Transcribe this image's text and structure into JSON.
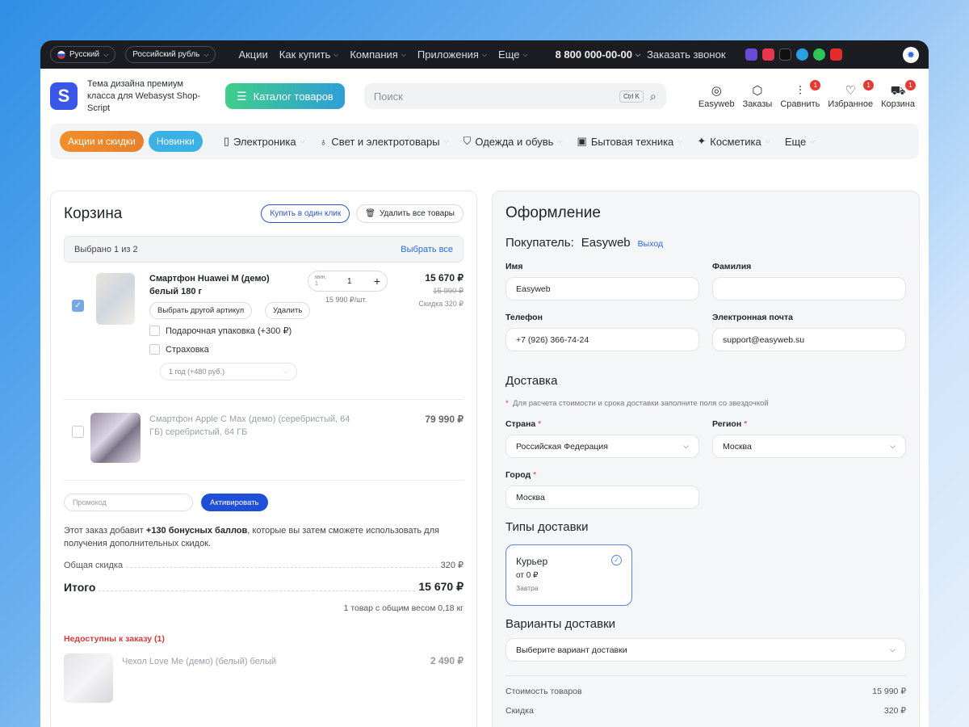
{
  "topbar": {
    "language": "Русский",
    "currency": "Российский рубль",
    "nav": [
      "Акции",
      "Как купить",
      "Компания",
      "Приложения",
      "Еще"
    ],
    "phone": "8 800 000-00-00",
    "callback": "Заказать звонок"
  },
  "header": {
    "tagline": "Тема дизайна премиум класса для Webasyst Shop-Script",
    "catalog_label": "Каталог товаров",
    "search_placeholder": "Поиск",
    "search_shortcut": "Ctrl K",
    "icons": [
      {
        "label": "Easyweb",
        "badge": ""
      },
      {
        "label": "Заказы",
        "badge": ""
      },
      {
        "label": "Сравнить",
        "badge": "1"
      },
      {
        "label": "Избранное",
        "badge": "1"
      },
      {
        "label": "Корзина",
        "badge": "1"
      }
    ]
  },
  "catbar": {
    "promo_chip": "Акции и скидки",
    "new_chip": "Новинки",
    "categories": [
      "Электроника",
      "Свет и электротовары",
      "Одежда и обувь",
      "Бытовая техника",
      "Косметика",
      "Еще"
    ]
  },
  "cart": {
    "title": "Корзина",
    "buy_one_click": "Купить в один клик",
    "delete_all": "Удалить все товары",
    "selected_text": "Выбрано 1 из 2",
    "select_all": "Выбрать все",
    "item1": {
      "name": "Смартфон Huawei M (демо)",
      "variant": "белый   180 г",
      "change_sku": "Выбрать другой артикул",
      "delete": "Удалить",
      "option_gift": "Подарочная упаковка (+300 ₽)",
      "option_insurance": "Страховка",
      "insurance_select": "1 год (+480 руб.)",
      "qty_min_label": "мин.",
      "qty_min_value": "1",
      "qty": "1",
      "unit_price": "15 990 ₽/шт.",
      "price": "15 670 ₽",
      "old_price": "15 990 ₽",
      "discount": "Скидка 320 ₽"
    },
    "item2": {
      "name": "Смартфон Apple C Max (демо) (серебристый, 64 ГБ)  серебристый, 64 ГБ",
      "price": "79 990 ₽"
    },
    "promo_placeholder": "Промокод",
    "activate": "Активировать",
    "bonus_pre": "Этот заказ добавит ",
    "bonus_strong": "+130 бонусных баллов",
    "bonus_post": ", которые вы затем сможете использовать для получения дополнительных скидок.",
    "total_discount_label": "Общая скидка",
    "total_discount": "320 ₽",
    "total_label": "Итого",
    "total": "15 670 ₽",
    "weight_text": "1 товар с общим весом 0,18 кг",
    "unavailable_title": "Недоступны к заказу (1)",
    "unavailable_item": {
      "name": "Чехол Love Me (демо) (белый)  белый",
      "price": "2 490 ₽"
    }
  },
  "checkout": {
    "title": "Оформление",
    "buyer_label": "Покупатель:",
    "buyer_name": "Easyweb",
    "logout": "Выход",
    "first_name_label": "Имя",
    "first_name": "Easyweb",
    "last_name_label": "Фамилия",
    "last_name": "",
    "phone_label": "Телефон",
    "phone": "+7 (926) 366-74-24",
    "email_label": "Электронная почта",
    "email": "support@easyweb.su",
    "delivery_title": "Доставка",
    "delivery_note": "Для расчета стоимости и срока доставки заполните поля со звездочкой",
    "country_label": "Страна",
    "country": "Российская Федерация",
    "region_label": "Регион",
    "region": "Москва",
    "city_label": "Город",
    "city": "Москва",
    "delivery_types_title": "Типы доставки",
    "courier": {
      "title": "Курьер",
      "price": "от 0 ₽",
      "date": "Завтра"
    },
    "delivery_variants_title": "Варианты доставки",
    "delivery_variant_placeholder": "Выберите вариант доставки",
    "goods_cost_label": "Стоимость товаров",
    "goods_cost": "15 990 ₽",
    "discount_label": "Скидка",
    "discount": "320 ₽"
  }
}
